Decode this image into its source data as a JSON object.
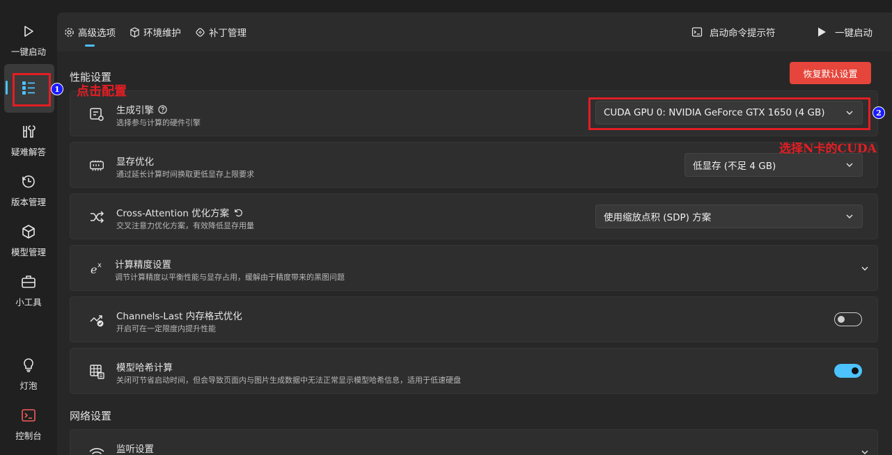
{
  "sidebar": {
    "items": [
      {
        "label": "一键启动",
        "icon": "play-icon"
      },
      {
        "label": "",
        "icon": "list-config-icon"
      },
      {
        "label": "疑难解答",
        "icon": "wrench-icon"
      },
      {
        "label": "版本管理",
        "icon": "history-icon"
      },
      {
        "label": "模型管理",
        "icon": "cube-icon"
      },
      {
        "label": "小工具",
        "icon": "toolbox-icon"
      },
      {
        "label": "灯泡",
        "icon": "lightbulb-icon"
      },
      {
        "label": "控制台",
        "icon": "console-icon"
      }
    ]
  },
  "topbar": {
    "tabs": [
      {
        "label": "高级选项",
        "icon": "gear-icon"
      },
      {
        "label": "环境维护",
        "icon": "package-icon"
      },
      {
        "label": "补丁管理",
        "icon": "patch-icon"
      }
    ],
    "console_prompt_label": "启动命令提示符",
    "launch_label": "一键启动"
  },
  "main": {
    "perf_section_title": "性能设置",
    "reset_label": "恢复默认设置",
    "cards": [
      {
        "title": "生成引擎",
        "desc": "选择参与计算的硬件引擎",
        "value": "CUDA GPU 0: NVIDIA GeForce GTX 1650 (4 GB)"
      },
      {
        "title": "显存优化",
        "desc": "通过延长计算时间换取更低显存上限要求",
        "value": "低显存 (不足 4 GB)"
      },
      {
        "title": "Cross-Attention 优化方案",
        "desc": "交叉注意力优化方案，有效降低显存用量",
        "value": "使用缩放点积 (SDP) 方案"
      },
      {
        "title": "计算精度设置",
        "desc": "调节计算精度以平衡性能与显存占用，缓解由于精度带来的黑图问题"
      },
      {
        "title": "Channels-Last 内存格式优化",
        "desc": "开启可在一定限度内提升性能",
        "toggle": false
      },
      {
        "title": "模型哈希计算",
        "desc": "关闭可节省启动时间，但会导致页面内与图片生成数据中无法正常显示模型哈希信息，适用于低速硬盘",
        "toggle": true
      }
    ],
    "network_section_title": "网络设置",
    "listen_title": "监听设置"
  },
  "annotations": {
    "step1_number": "1",
    "step1_text": "点击配置",
    "step2_number": "2",
    "step2_text": "选择N卡的CUDA"
  },
  "colors": {
    "accent": "#4cc2ff",
    "reset_button": "#e5453a",
    "annotation_red": "#e31e24",
    "badge_blue": "#1a1aff"
  }
}
